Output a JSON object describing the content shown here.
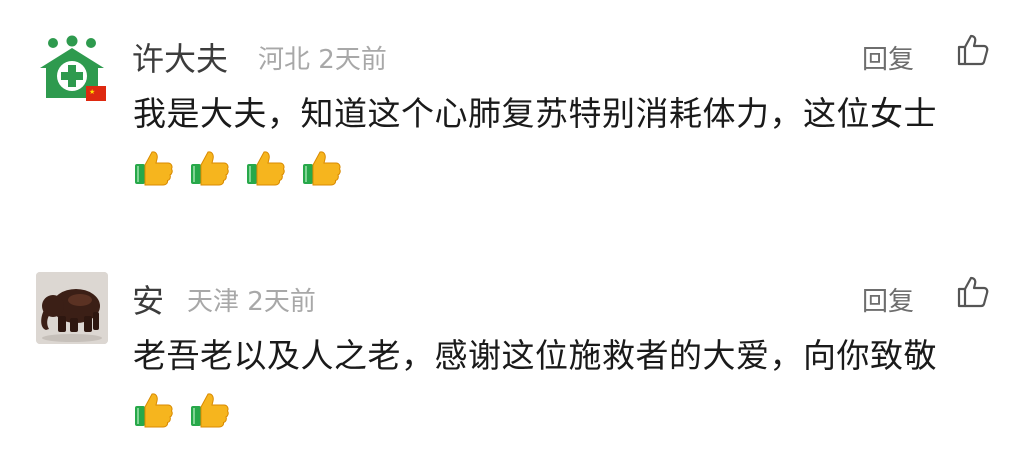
{
  "comments": [
    {
      "name": "许大夫",
      "location": "河北",
      "time": "2天前",
      "reply_label": "回复",
      "text": "我是大夫，知道这个心肺复苏特别消耗体力，这位女士",
      "emoji_icon": "thumbs-up-icon",
      "emoji_count": 4,
      "avatar": "medical-cross-avatar-with-flag"
    },
    {
      "name": "安",
      "location": "天津",
      "time": "2天前",
      "reply_label": "回复",
      "text": "老吾老以及人之老，感谢这位施救者的大爱，向你致敬",
      "emoji_icon": "thumbs-up-icon",
      "emoji_count": 2,
      "avatar": "elephant-figurine-avatar"
    }
  ],
  "colors": {
    "avatar_green": "#2e9a4e",
    "flag_red": "#de2910",
    "name_text": "#3c3c3c",
    "meta_text": "#a8a8a8",
    "body_text": "#1a1a1a",
    "thumb_yellow": "#f6b51e",
    "thumb_cuff": "#27a84a"
  }
}
